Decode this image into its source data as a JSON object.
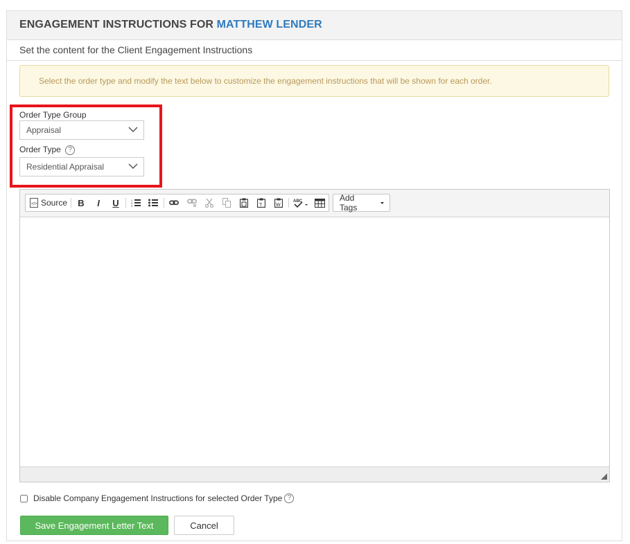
{
  "header": {
    "title_prefix": "ENGAGEMENT INSTRUCTIONS FOR",
    "lender_name": "MATTHEW LENDER"
  },
  "subheader": "Set the content for the Client Engagement Instructions",
  "alert_text": "Select the order type and modify the text below to customize the engagement instructions that will be shown for each order.",
  "order_type_group": {
    "label": "Order Type Group",
    "value": "Appraisal"
  },
  "order_type": {
    "label": "Order Type",
    "help": "?",
    "value": "Residential Appraisal"
  },
  "toolbar": {
    "source_label": "Source",
    "bold_label": "B",
    "italic_label": "I",
    "underline_label": "U",
    "add_tags_label": "Add Tags",
    "icons": [
      "source-icon",
      "bold-icon",
      "italic-icon",
      "underline-icon",
      "numbered-list-icon",
      "bulleted-list-icon",
      "link-icon",
      "unlink-icon",
      "cut-icon",
      "copy-icon",
      "paste-icon",
      "paste-text-icon",
      "paste-word-icon",
      "spellcheck-icon",
      "table-icon"
    ]
  },
  "editor_content": "",
  "disable_checkbox": {
    "label": "Disable Company Engagement Instructions for selected Order Type",
    "checked": false,
    "help": "?"
  },
  "buttons": {
    "save": "Save Engagement Letter Text",
    "cancel": "Cancel"
  },
  "colors": {
    "header_accent": "#2e7bbf",
    "alert_text": "#b9995a",
    "alert_bg": "#fcf8e3",
    "highlight_border": "#e8151b",
    "save_button": "#5cb85c"
  }
}
